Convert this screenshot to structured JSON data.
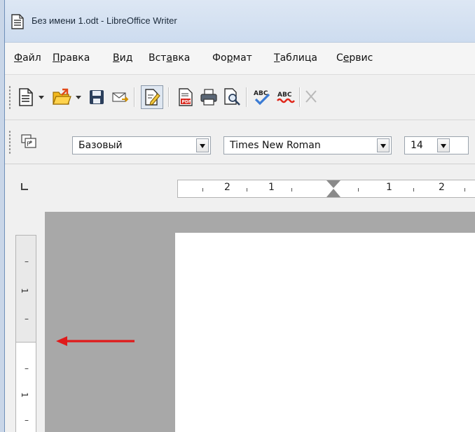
{
  "window": {
    "title": "Без имени 1.odt - LibreOffice Writer"
  },
  "menu": [
    {
      "label": "Файл",
      "underline_index": 0
    },
    {
      "label": "Правка",
      "underline_index": 0
    },
    {
      "label": "Вид",
      "underline_index": 0
    },
    {
      "label": "Вставка",
      "underline_index": 3
    },
    {
      "label": "Формат",
      "underline_index": 2
    },
    {
      "label": "Таблица",
      "underline_index": 0
    },
    {
      "label": "Сервис",
      "underline_index": 1
    }
  ],
  "toolbar_standard": {
    "icons": [
      "new-document-icon",
      "open-folder-icon",
      "save-icon",
      "email-icon",
      "edit-mode-icon",
      "export-pdf-icon",
      "print-icon",
      "print-preview-icon",
      "spellcheck-icon",
      "auto-spellcheck-icon",
      "cut-icon"
    ]
  },
  "toolbar_formatting": {
    "styles_icon": "styles-window-icon",
    "paragraph_style": "Базовый",
    "font_name": "Times New Roman",
    "font_size": "14"
  },
  "ruler": {
    "horizontal_labels": [
      "2",
      "1",
      "1",
      "2"
    ],
    "vertical_labels": [
      "1",
      "1"
    ]
  },
  "colors": {
    "titlebar": "#cddcef",
    "canvas": "#a8a8a8",
    "annotation_arrow": "#e01a1a"
  }
}
